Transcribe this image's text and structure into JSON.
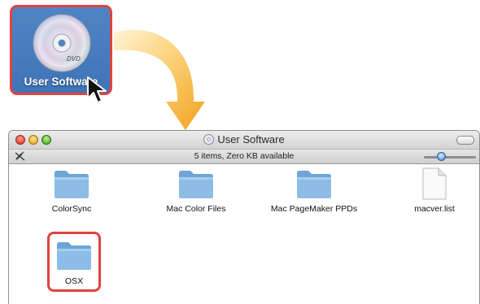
{
  "desktop": {
    "icon_label": "User Software",
    "icon": "dvd-disc-icon",
    "disc_text": "DVD"
  },
  "window": {
    "title": "User Software",
    "status": "5 items, Zero KB available",
    "items": [
      {
        "label": "ColorSync",
        "icon": "folder-icon"
      },
      {
        "label": "Mac Color Files",
        "icon": "folder-icon"
      },
      {
        "label": "Mac PageMaker PPDs",
        "icon": "folder-icon"
      },
      {
        "label": "macver.list",
        "icon": "document-icon"
      },
      {
        "label": "OSX",
        "icon": "folder-icon"
      }
    ],
    "icon_size_slider": 0.3
  },
  "colors": {
    "highlight": "#e0433f",
    "arrow": "#f5b22a",
    "desktop_selection": "#4378bb",
    "folder": "#7fb1de"
  }
}
